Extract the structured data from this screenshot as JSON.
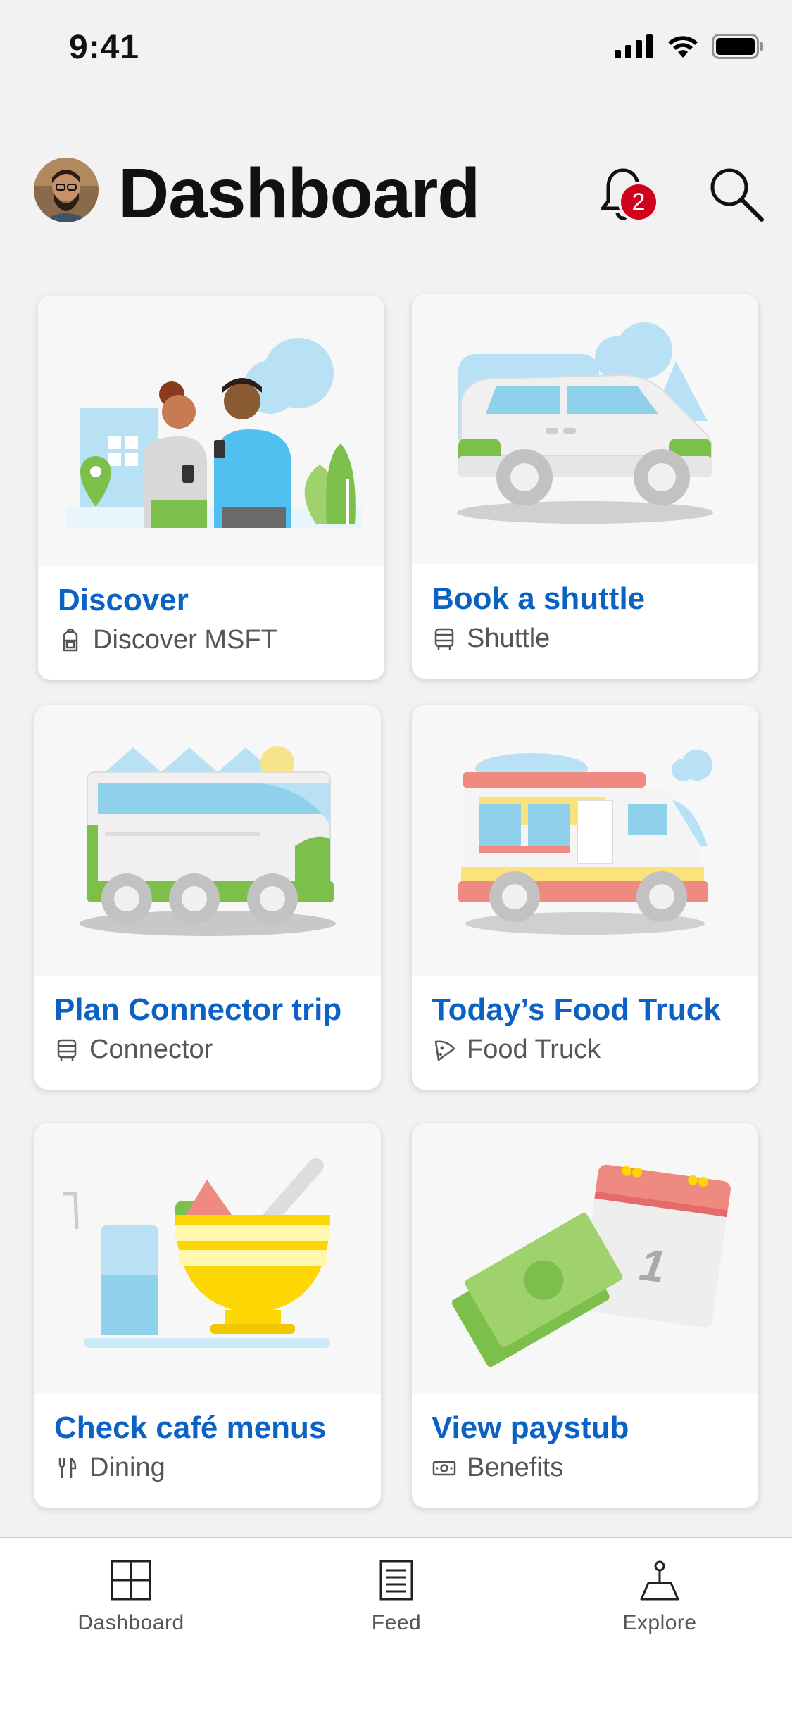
{
  "status": {
    "time": "9:41"
  },
  "header": {
    "title": "Dashboard",
    "notification_count": "2"
  },
  "cards": [
    {
      "title": "Discover",
      "subtitle": "Discover MSFT",
      "icon": "backpack-icon"
    },
    {
      "title": "Book a shuttle",
      "subtitle": "Shuttle",
      "icon": "bus-icon"
    },
    {
      "title": "Plan Connector trip",
      "subtitle": "Connector",
      "icon": "bus-icon"
    },
    {
      "title": "Today’s Food Truck",
      "subtitle": "Food Truck",
      "icon": "pizza-slice-icon"
    },
    {
      "title": "Check café menus",
      "subtitle": "Dining",
      "icon": "fork-knife-icon"
    },
    {
      "title": "View paystub",
      "subtitle": "Benefits",
      "icon": "money-icon"
    }
  ],
  "tabs": [
    {
      "label": "Dashboard",
      "icon": "dashboard-grid-icon"
    },
    {
      "label": "Feed",
      "icon": "feed-list-icon"
    },
    {
      "label": "Explore",
      "icon": "map-pin-icon"
    }
  ],
  "colors": {
    "accent": "#0b62c4",
    "badge": "#d0021b",
    "background": "#f2f2f2"
  }
}
